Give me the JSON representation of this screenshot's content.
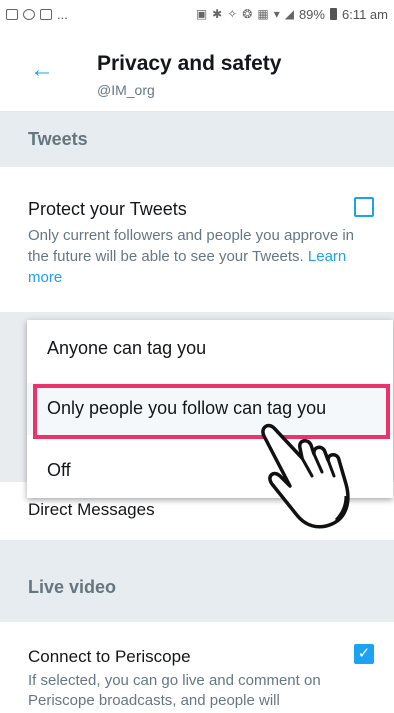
{
  "status_bar": {
    "left_text": "...",
    "battery": "89%",
    "time": "6:11 am"
  },
  "header": {
    "title": "Privacy and safety",
    "handle": "@IM_org"
  },
  "sections": {
    "tweets": "Tweets",
    "live_video": "Live video"
  },
  "protect": {
    "title": "Protect your Tweets",
    "description": "Only current followers and people you approve in the future will be able to see your Tweets. ",
    "learn_more": "Learn more",
    "checked": false
  },
  "tag_menu": {
    "options": [
      "Anyone can tag you",
      "Only people you follow can tag you",
      "Off"
    ],
    "highlighted_index": 1
  },
  "direct_messages": {
    "label": "Direct Messages"
  },
  "periscope": {
    "title": "Connect to Periscope",
    "description": "If selected, you can go live and comment on Periscope broadcasts, and people will",
    "checked": true
  },
  "colors": {
    "accent": "#1da1f2",
    "highlight": "#e8336b",
    "section_bg": "#e6ecf0"
  }
}
